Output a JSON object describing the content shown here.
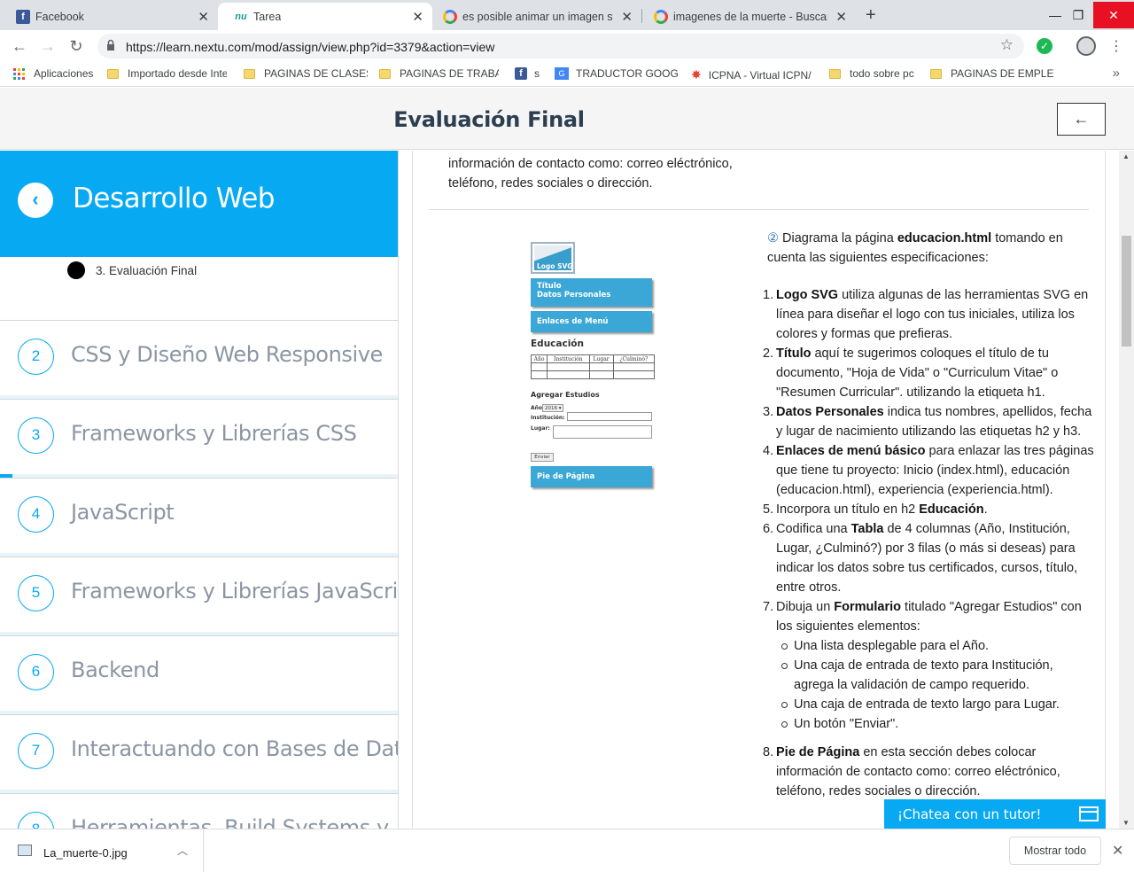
{
  "browser": {
    "tabs": [
      {
        "title": "Facebook",
        "favicon": "facebook-icon"
      },
      {
        "title": "Tarea",
        "favicon": "nu-icon"
      },
      {
        "title": "es posible animar un imagen svg",
        "favicon": "google-icon"
      },
      {
        "title": "imagenes de la muerte - Buscar c",
        "favicon": "google-icon"
      }
    ],
    "url": "https://learn.nextu.com/mod/assign/view.php?id=3379&action=view",
    "bookmarks": [
      {
        "label": "Aplicaciones",
        "icon": "apps-grid-icon"
      },
      {
        "label": "Importado desde Inte",
        "icon": "folder-icon"
      },
      {
        "label": "PAGINAS DE CLASES",
        "icon": "folder-icon"
      },
      {
        "label": "PAGINAS DE TRABAJ",
        "icon": "folder-icon"
      },
      {
        "label": "s",
        "icon": "facebook-icon"
      },
      {
        "label": "TRADUCTOR GOOGL",
        "icon": "translate-icon"
      },
      {
        "label": "ICPNA - Virtual ICPN/",
        "icon": "star-logo-icon"
      },
      {
        "label": "todo sobre pc",
        "icon": "folder-icon"
      },
      {
        "label": "PAGINAS DE EMPLEO",
        "icon": "folder-icon"
      }
    ]
  },
  "header": {
    "title": "Evaluación Final",
    "back_arrow": "←"
  },
  "sidebar": {
    "course_title": "Desarrollo Web",
    "current_lesson": "3. Evaluación Final",
    "modules": [
      {
        "number": "2",
        "name": "CSS y Diseño Web Responsive",
        "progress": 0
      },
      {
        "number": "3",
        "name": "Frameworks y Librerías CSS",
        "progress": 0.03
      },
      {
        "number": "4",
        "name": "JavaScript",
        "progress": 0
      },
      {
        "number": "5",
        "name": "Frameworks y Librerías JavaScript",
        "progress": 0
      },
      {
        "number": "6",
        "name": "Backend",
        "progress": 0
      },
      {
        "number": "7",
        "name": "Interactuando con Bases de Datos",
        "progress": 0
      },
      {
        "number": "8",
        "name": "Herramientas, Build Systems y",
        "progress": 0
      }
    ]
  },
  "content": {
    "top_text": "información de contacto como: correo eléctrónico, teléfono, redes sociales o dirección.",
    "diagram": {
      "logo": "Logo SVG",
      "title_box_1": "Título",
      "title_box_2": "Datos Personales",
      "menu_box": "Enlaces de Menú",
      "heading": "Educación",
      "table_headers": [
        "Año",
        "Institución",
        "Lugar",
        "¿Culminó?"
      ],
      "form_title": "Agregar Estudios",
      "label_year": "Año:",
      "year_value": "2016 ▾",
      "label_institution": "Institución:",
      "label_place": "Lugar:",
      "button": "Enviar",
      "footer": "Pie de Página"
    },
    "intro_num": "②",
    "intro_a": " Diagrama la página ",
    "intro_b": "educacion.html",
    "intro_c": " tomando en cuenta las siguientes especificaciones:",
    "items": [
      {
        "n": "1.",
        "bold": "Logo SVG",
        "text": " utiliza algunas de las herramientas SVG en línea para diseñar el logo con tus iniciales, utiliza los colores y formas que prefieras."
      },
      {
        "n": "2.",
        "bold": "Título",
        "text": " aquí te sugerimos coloques el título de tu documento, \"Hoja de Vida\" o \"Curriculum Vitae\" o \"Resumen Curricular\". utilizando la etiqueta h1."
      },
      {
        "n": "3.",
        "bold": "Datos Personales",
        "text": " indica tus nombres, apellidos, fecha y lugar de nacimiento utilizando las etiquetas h2 y h3."
      },
      {
        "n": "4.",
        "bold": "Enlaces de menú básico",
        "text": " para enlazar las tres páginas que tiene tu proyecto: Inicio (index.html), educación (educacion.html), experiencia (experiencia.html)."
      },
      {
        "n": "5.",
        "pre": "Incorpora un título en h2 ",
        "bold": "Educación",
        "text": "."
      },
      {
        "n": "6.",
        "pre": "Codifica una ",
        "bold": "Tabla",
        "text": " de 4 columnas (Año, Institución, Lugar, ¿Culminó?) por 3 filas (o más si deseas) para indicar los datos sobre tus certificados, cursos, título, entre otros."
      },
      {
        "n": "7.",
        "pre": "Dibuja un ",
        "bold": "Formulario",
        "text": " titulado \"Agregar Estudios\" con los siguientes elementos:"
      },
      {
        "n": "8.",
        "bold": "Pie de Página",
        "text": " en esta sección debes colocar información de contacto como: correo eléctrónico, teléfono, redes sociales o dirección."
      }
    ],
    "subitems": [
      "Una lista desplegable para el Año.",
      "Una caja de entrada de texto para Institución, agrega la validación de campo requerido.",
      "Una caja de entrada de texto largo para Lugar.",
      "Un botón \"Enviar\"."
    ]
  },
  "chat": {
    "label": "¡Chatea con un tutor!"
  },
  "downloads": {
    "file": "La_muerte-0.jpg",
    "show_all": "Mostrar todo"
  },
  "colors": {
    "accent": "#07a9f2",
    "diagram_blue": "#3aa7d6"
  }
}
